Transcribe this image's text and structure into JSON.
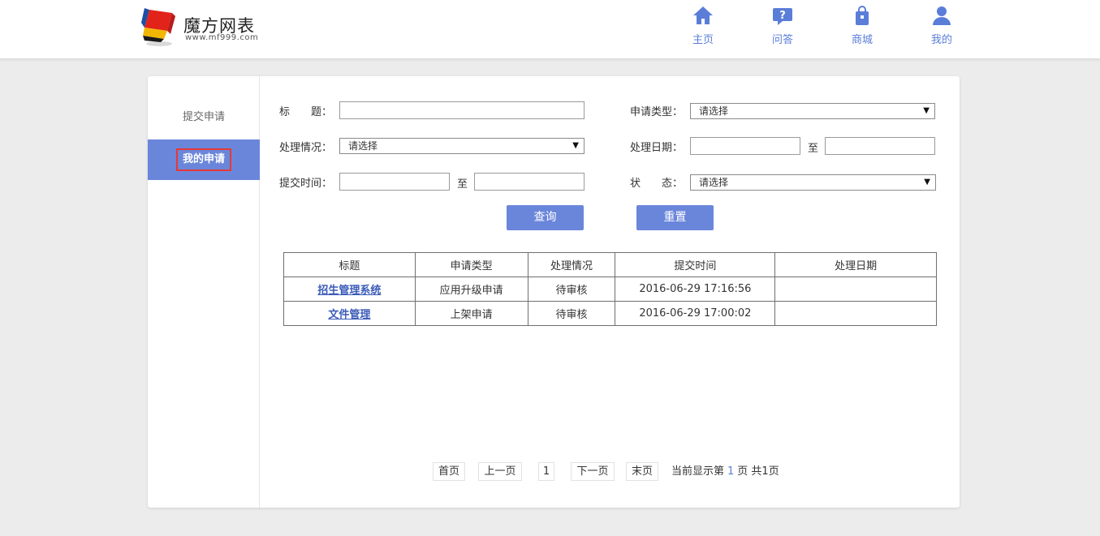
{
  "header": {
    "logo_title": "魔方网表",
    "logo_subtitle": "www.mf999.com",
    "nav": [
      {
        "label": "主页",
        "icon": "home-icon"
      },
      {
        "label": "问答",
        "icon": "question-icon"
      },
      {
        "label": "商城",
        "icon": "shopping-bag-icon"
      },
      {
        "label": "我的",
        "icon": "user-icon"
      }
    ]
  },
  "sidebar": {
    "items": [
      {
        "label": "提交申请",
        "active": false
      },
      {
        "label": "我的申请",
        "active": true
      }
    ]
  },
  "form": {
    "title_label": "标　　题：",
    "title_value": "",
    "type_label": "申请类型：",
    "type_value": "请选择",
    "status_label": "处理情况：",
    "status_value": "请选择",
    "handle_date_label": "处理日期：",
    "submit_time_label": "提交时间：",
    "state_label": "状　　态：",
    "state_value": "请选择",
    "to_label": "至",
    "query_button": "查询",
    "reset_button": "重置"
  },
  "table": {
    "columns": [
      "标题",
      "申请类型",
      "处理情况",
      "提交时间",
      "处理日期"
    ],
    "rows": [
      {
        "title": "招生管理系统",
        "type": "应用升级申请",
        "status": "待审核",
        "submit_time": "2016-06-29 17:16:56",
        "handle_date": ""
      },
      {
        "title": "文件管理",
        "type": "上架申请",
        "status": "待审核",
        "submit_time": "2016-06-29 17:00:02",
        "handle_date": ""
      }
    ]
  },
  "pagination": {
    "first": "首页",
    "prev": "上一页",
    "page": "1",
    "next": "下一页",
    "last": "末页",
    "info_prefix": "当前显示第",
    "current": "1",
    "info_suffix": "页 共1页"
  },
  "colors": {
    "accent": "#6a86db",
    "link": "#3b5bb8",
    "highlight_border": "#e53935"
  }
}
